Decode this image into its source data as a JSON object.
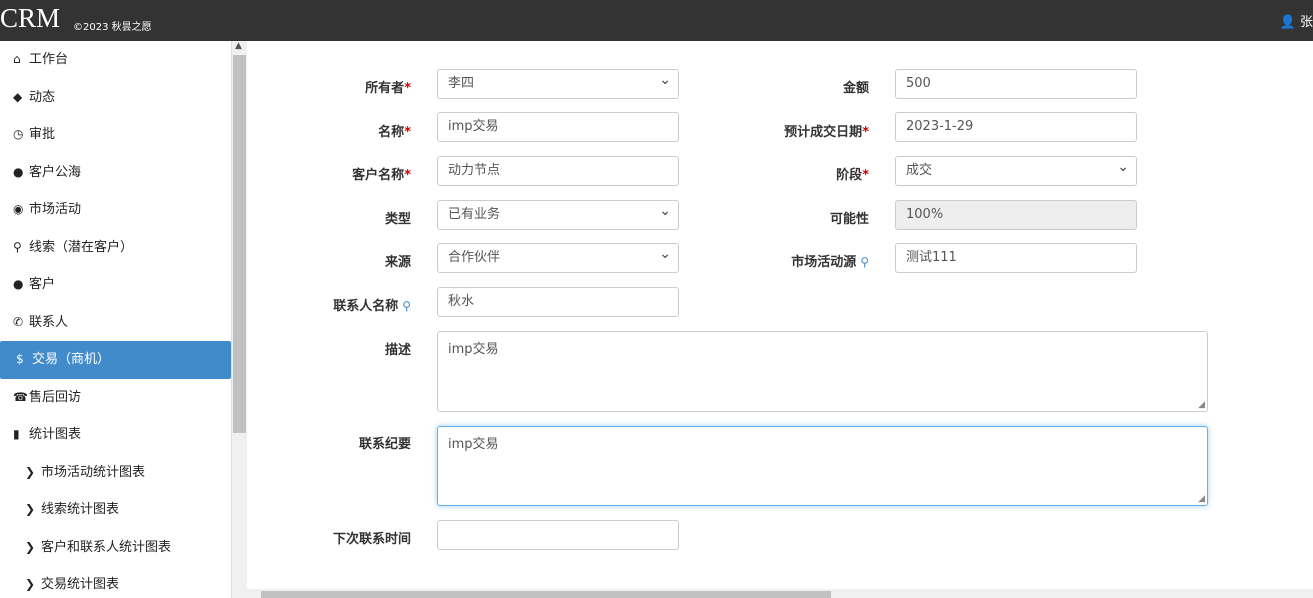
{
  "header": {
    "brand": "CRM",
    "copyright": "©2023 秋昙之愿",
    "user_initial": "张"
  },
  "sidebar": {
    "items": [
      {
        "icon": "home-icon",
        "label": "工作台"
      },
      {
        "icon": "tag-icon",
        "label": "动态"
      },
      {
        "icon": "clock-icon",
        "label": "审批"
      },
      {
        "icon": "user-icon",
        "label": "客户公海"
      },
      {
        "icon": "play-circle-icon",
        "label": "市场活动"
      },
      {
        "icon": "search-icon",
        "label": "线索（潜在客户）"
      },
      {
        "icon": "user-icon",
        "label": "客户"
      },
      {
        "icon": "phone-icon",
        "label": "联系人"
      },
      {
        "icon": "dollar-icon",
        "label": "交易（商机）"
      },
      {
        "icon": "phone-alt-icon",
        "label": "售后回访"
      },
      {
        "icon": "stats-icon",
        "label": "统计图表"
      },
      {
        "icon": "chevron-right-icon",
        "label": "市场活动统计图表"
      },
      {
        "icon": "chevron-right-icon",
        "label": "线索统计图表"
      },
      {
        "icon": "chevron-right-icon",
        "label": "客户和联系人统计图表"
      },
      {
        "icon": "chevron-right-icon",
        "label": "交易统计图表"
      }
    ],
    "active_index": 8
  },
  "form": {
    "owner": {
      "label": "所有者",
      "value": "李四"
    },
    "amount": {
      "label": "金额",
      "value": "500"
    },
    "name": {
      "label": "名称",
      "value": "imp交易"
    },
    "expected_date": {
      "label": "预计成交日期",
      "value": "2023-1-29"
    },
    "customer_name": {
      "label": "客户名称",
      "value": "动力节点"
    },
    "stage": {
      "label": "阶段",
      "value": "成交"
    },
    "type": {
      "label": "类型",
      "value": "已有业务"
    },
    "possibility": {
      "label": "可能性",
      "value": "100%"
    },
    "source": {
      "label": "来源",
      "value": "合作伙伴"
    },
    "activity_source": {
      "label": "市场活动源",
      "value": "测试111"
    },
    "contact_name": {
      "label": "联系人名称",
      "value": "秋水"
    },
    "description": {
      "label": "描述",
      "value": "imp交易"
    },
    "contact_summary": {
      "label": "联系纪要",
      "value": "imp交易"
    },
    "next_contact_time": {
      "label": "下次联系时间",
      "value": ""
    }
  }
}
